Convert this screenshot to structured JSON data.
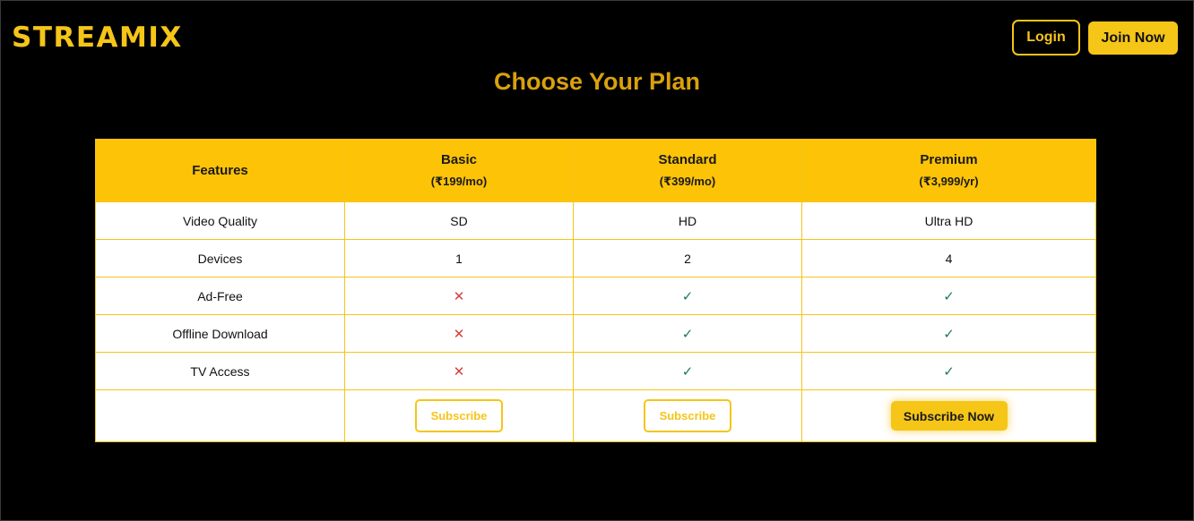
{
  "brand": {
    "name": "STREAMIX",
    "color": "#f5c518"
  },
  "nav": {
    "login_label": "Login",
    "join_label": "Join Now"
  },
  "page_title": "Choose Your Plan",
  "table": {
    "features_header": "Features",
    "plans": [
      {
        "name": "Basic",
        "price": "(₹199/mo)",
        "subscribe_label": "Subscribe"
      },
      {
        "name": "Standard",
        "price": "(₹399/mo)",
        "subscribe_label": "Subscribe"
      },
      {
        "name": "Premium",
        "price": "(₹3,999/yr)",
        "subscribe_label": "Subscribe Now"
      }
    ],
    "rows": [
      {
        "feature": "Video Quality",
        "values": [
          "SD",
          "HD",
          "Ultra HD"
        ]
      },
      {
        "feature": "Devices",
        "values": [
          "1",
          "2",
          "4"
        ]
      },
      {
        "feature": "Ad-Free",
        "values": [
          "no",
          "yes",
          "yes"
        ]
      },
      {
        "feature": "Offline Download",
        "values": [
          "no",
          "yes",
          "yes"
        ]
      },
      {
        "feature": "TV Access",
        "values": [
          "no",
          "yes",
          "yes"
        ]
      }
    ],
    "icons": {
      "no": "✕",
      "yes": "✓"
    }
  },
  "colors": {
    "accent": "#f5c518",
    "header_bg": "#fdc307",
    "cross": "#d93c3c",
    "check": "#1e7b4f"
  }
}
